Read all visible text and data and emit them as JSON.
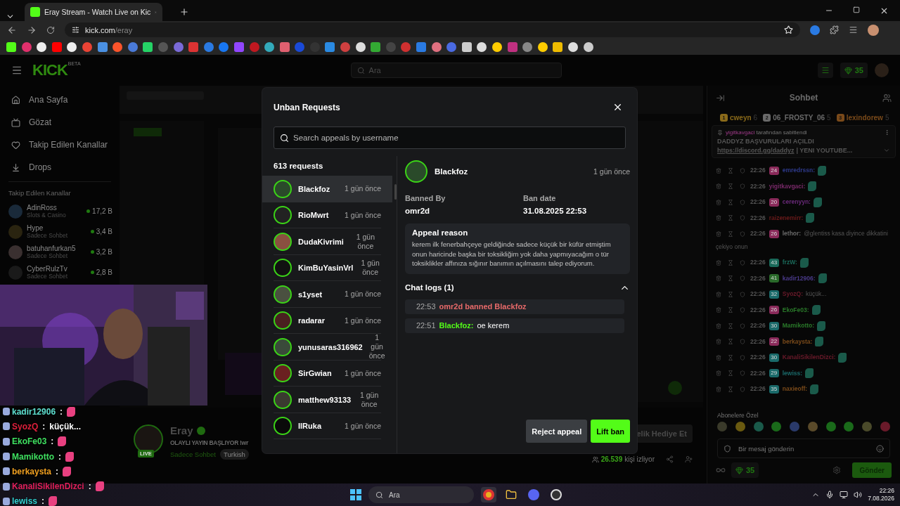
{
  "browser": {
    "tab_title": "Eray Stream - Watch Live on Kic",
    "url_host": "kick.com",
    "url_path": "/eray"
  },
  "site": {
    "logo": "KICK",
    "logo_badge": "BETA",
    "search_placeholder": "Ara",
    "points": "35"
  },
  "sidebar": {
    "nav": [
      {
        "kind": "home",
        "label": "Ana Sayfa"
      },
      {
        "kind": "browse",
        "label": "Gözat"
      },
      {
        "kind": "following",
        "label": "Takip Edilen Kanallar"
      },
      {
        "kind": "drops",
        "label": "Drops"
      }
    ],
    "followed_title": "Takip Edilen Kanallar",
    "followed": [
      {
        "name": "AdinRoss",
        "category": "Slots & Casino",
        "viewers": "17,2 B"
      },
      {
        "name": "Hype",
        "category": "Sadece Sohbet",
        "viewers": "3,4 B"
      },
      {
        "name": "batuhanfurkan5",
        "category": "Sadece Sohbet",
        "viewers": "3,2 B"
      },
      {
        "name": "CyberRulzTv",
        "category": "Sadece Sohbet",
        "viewers": "2,8 B"
      }
    ]
  },
  "stream": {
    "channel": "Eray",
    "live": "LIVE",
    "title": "OLAYLI YAYIN BAŞLIYOR !wr",
    "category": "Sadece Sohbet",
    "tag": "Turkish",
    "gift": "elik Hediye Et",
    "viewers": "26.539",
    "viewers_suffix": "kişi izliyor"
  },
  "chat": {
    "title": "Sohbet",
    "leaders": [
      {
        "rank": "1",
        "name": "cweyn",
        "count": "6",
        "color": "#8a6a1a"
      },
      {
        "rank": "2",
        "name": "06_FROSTY_06",
        "count": "5",
        "color": "#6a6a6a"
      },
      {
        "rank": "3",
        "name": "lexindorew",
        "count": "5",
        "color": "#7a4a1a"
      }
    ],
    "pinned": {
      "by": "yigitkavgaci",
      "by_suffix": "tarafından sabitlendi",
      "line": "DADDYZ BAŞVURULARI AÇILDI",
      "link": "https://discord.gg/daddyz",
      "rest": "| YENI YOUTUBE..."
    },
    "messages": [
      {
        "time": "22:26",
        "badge": {
          "text": "24",
          "color": "#8a2a5a"
        },
        "name": "emredrssn:",
        "color": "#2e3a8a",
        "emote": true
      },
      {
        "time": "22:26",
        "name": "yigitkavgaci:",
        "color": "#7a2a6a",
        "emote": true
      },
      {
        "time": "22:26",
        "badge": {
          "text": "20",
          "color": "#8a2a5a"
        },
        "name": "cerenyyn:",
        "color": "#6a2a7a",
        "emote": true
      },
      {
        "time": "22:26",
        "name": "raizenemirr:",
        "color": "#6a1a1a",
        "emote": true
      },
      {
        "time": "22:26",
        "badge": {
          "text": "26",
          "color": "#8a2a5a"
        },
        "name": "lethor:",
        "color": "#6a6a6a",
        "text": "@glentiss kasa diyince dikkatini çekiyo onun",
        "emote": false
      },
      {
        "time": "22:26",
        "badge": {
          "text": "43",
          "color": "#1a6a5a"
        },
        "name": "frzW:",
        "color": "#1a6a5a",
        "emote": true
      },
      {
        "time": "22:26",
        "badge": {
          "text": "41",
          "color": "#2a6a2a"
        },
        "name": "kadir12906:",
        "color": "#4a3a8a",
        "emote": true
      },
      {
        "time": "22:26",
        "badge": {
          "text": "32",
          "color": "#1a6a6a"
        },
        "name": "SyozQ:",
        "color": "#6a1a2a",
        "text": "küçük...",
        "emote": false
      },
      {
        "time": "22:26",
        "badge": {
          "text": "26",
          "color": "#8a2a5a"
        },
        "name": "EkoFe03:",
        "color": "#2a7a2a",
        "emote": true
      },
      {
        "time": "22:26",
        "badge": {
          "text": "30",
          "color": "#1a6a6a"
        },
        "name": "Mamikotto:",
        "color": "#2a7a2a",
        "emote": true
      },
      {
        "time": "22:26",
        "badge": {
          "text": "22",
          "color": "#8a2a5a"
        },
        "name": "berkaysta:",
        "color": "#7a4a1a",
        "emote": true
      },
      {
        "time": "22:26",
        "badge": {
          "text": "30",
          "color": "#1a6a6a"
        },
        "name": "KanaliSikilenDizci:",
        "color": "#6a1a2a",
        "emote": true
      },
      {
        "time": "22:26",
        "badge": {
          "text": "29",
          "color": "#1a6a6a"
        },
        "name": "lewiss:",
        "color": "#1a6a6a",
        "emote": true
      },
      {
        "time": "22:26",
        "badge": {
          "text": "35",
          "color": "#1a6a6a"
        },
        "name": "naxieoff:",
        "color": "#7a4a1a",
        "emote": true
      }
    ],
    "subs_label": "Abonelere Özel",
    "input_placeholder": "Bir mesaj gönderin",
    "points": "35",
    "send": "Gönder"
  },
  "modal": {
    "title": "Unban Requests",
    "search_placeholder": "Search appeals by username",
    "count": "613 requests",
    "requests": [
      {
        "name": "Blackfoz",
        "time": "1 gün önce",
        "selected": true
      },
      {
        "name": "RioMwrt",
        "time": "1 gün önce",
        "selected": false
      },
      {
        "name": "DudaKivrimi",
        "time": "1 gün önce",
        "selected": false
      },
      {
        "name": "KimBuYasinVrl",
        "time": "1 gün önce",
        "selected": false
      },
      {
        "name": "s1yset",
        "time": "1 gün önce",
        "selected": false
      },
      {
        "name": "radarar",
        "time": "1 gün önce",
        "selected": false
      },
      {
        "name": "yunusaras316962",
        "time": "1 gün önce",
        "selected": false
      },
      {
        "name": "SirGwian",
        "time": "1 gün önce",
        "selected": false
      },
      {
        "name": "matthew93133",
        "time": "1 gün önce",
        "selected": false
      },
      {
        "name": "IlRuka",
        "time": "1 gün önce",
        "selected": false
      }
    ],
    "detail": {
      "name": "Blackfoz",
      "time": "1 gün önce",
      "banned_by_label": "Banned By",
      "banned_by": "omr2d",
      "ban_date_label": "Ban date",
      "ban_date": "31.08.2025 22:53",
      "reason_title": "Appeal reason",
      "reason": "kerem ilk fenerbahçeye geldiğinde sadece küçük bir küfür etmiştim onun haricinde başka bir toksikliğim yok daha yapmıyacağım o tür toksiklikler affınıza sığınır banımın açılmasını talep ediyorum.",
      "logs_title": "Chat logs (1)",
      "logs_expanded": true,
      "logs": [
        {
          "kind": "ban",
          "time": "22:53",
          "text": "omr2d banned Blackfoz"
        },
        {
          "kind": "message",
          "time": "22:51",
          "user": "Blackfoz:",
          "text": "oe kerem"
        }
      ]
    },
    "buttons": [
      {
        "kind": "secondary",
        "label": "Reject appeal"
      },
      {
        "kind": "primary",
        "label": "Lift ban"
      }
    ]
  },
  "overlay_chat": [
    {
      "name": "kadir12906",
      "color": "#5ee0d0",
      "emote": true
    },
    {
      "name": "SyozQ",
      "color": "#e0203c",
      "text": "küçük...",
      "emote": false
    },
    {
      "name": "EkoFe03",
      "color": "#3fe060",
      "emote": true
    },
    {
      "name": "Mamikotto",
      "color": "#3fe060",
      "emote": true
    },
    {
      "name": "berkaysta",
      "color": "#f0a020",
      "emote": true
    },
    {
      "name": "KanaliSikilenDizci",
      "color": "#e0205a",
      "emote": true
    },
    {
      "name": "lewiss",
      "color": "#30d0d0",
      "emote": true
    }
  ],
  "overlay_separator": ":",
  "taskbar": {
    "search": "Ara",
    "time": "22:26",
    "date": "7.08.2026"
  }
}
